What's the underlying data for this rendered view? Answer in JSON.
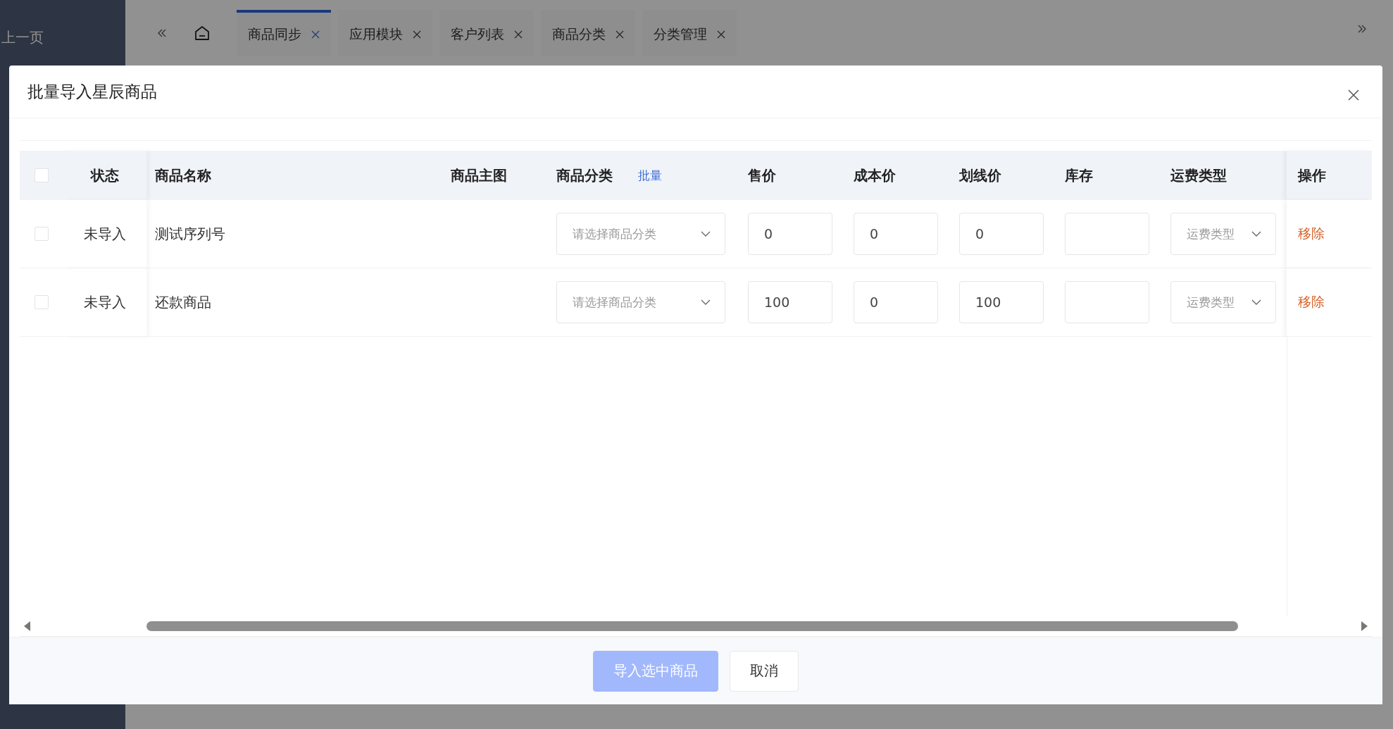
{
  "sidebar": {
    "back_link": "上一页"
  },
  "tabs": [
    {
      "label": "商品同步",
      "selected": true
    },
    {
      "label": "应用模块",
      "selected": false
    },
    {
      "label": "客户列表",
      "selected": false
    },
    {
      "label": "商品分类",
      "selected": false
    },
    {
      "label": "分类管理",
      "selected": false
    }
  ],
  "dialog": {
    "title": "批量导入星辰商品",
    "table": {
      "columns": [
        "状态",
        "商品名称",
        "商品主图",
        "商品分类",
        "售价",
        "成本价",
        "划线价",
        "库存",
        "运费类型",
        "操作"
      ],
      "batch_link": "批量",
      "select_all_checked": false,
      "rows": [
        {
          "checked": false,
          "status": "未导入",
          "name": "测试序列号",
          "category_placeholder": "请选择商品分类",
          "price": "0",
          "cost": "0",
          "list_price": "0",
          "shipping_placeholder": "运费类型",
          "action": "移除"
        },
        {
          "checked": false,
          "status": "未导入",
          "name": "还款商品",
          "category_placeholder": "请选择商品分类",
          "price": "100",
          "cost": "0",
          "list_price": "100",
          "shipping_placeholder": "运费类型",
          "action": "移除"
        }
      ]
    },
    "buttons": [
      {
        "label": "导入选中商品",
        "kind": "primary",
        "disabled": true
      },
      {
        "label": "取消",
        "kind": "default",
        "disabled": false
      }
    ]
  }
}
